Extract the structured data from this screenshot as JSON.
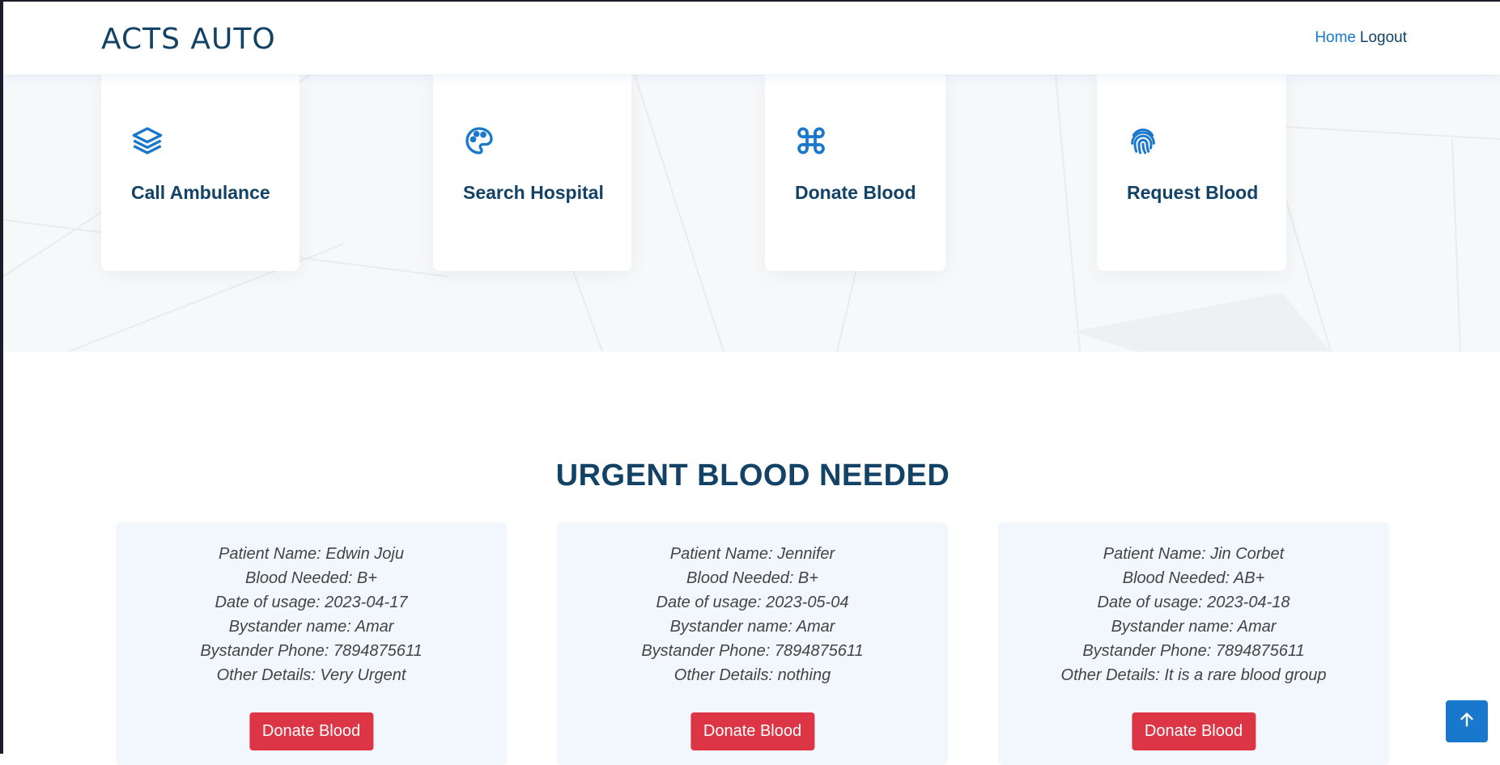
{
  "header": {
    "logo": "ACTS AUTO",
    "nav": {
      "home": "Home",
      "logout": "Logout"
    }
  },
  "features": [
    {
      "label": "Call Ambulance",
      "icon": "layers-icon"
    },
    {
      "label": "Search Hospital",
      "icon": "palette-icon"
    },
    {
      "label": "Donate Blood",
      "icon": "command-icon"
    },
    {
      "label": "Request Blood",
      "icon": "fingerprint-icon"
    }
  ],
  "section": {
    "title": "URGENT BLOOD NEEDED"
  },
  "requests": [
    {
      "patient": "Patient Name: Edwin Joju",
      "blood": "Blood Needed: B+",
      "date": "Date of usage: 2023-04-17",
      "bystander": "Bystander name: Amar",
      "phone": "Bystander Phone: 7894875611",
      "details": "Other Details: Very Urgent",
      "button": "Donate Blood"
    },
    {
      "patient": "Patient Name: Jennifer",
      "blood": "Blood Needed: B+",
      "date": "Date of usage: 2023-05-04",
      "bystander": "Bystander name: Amar",
      "phone": "Bystander Phone: 7894875611",
      "details": "Other Details: nothing",
      "button": "Donate Blood"
    },
    {
      "patient": "Patient Name: Jin Corbet",
      "blood": "Blood Needed: AB+",
      "date": "Date of usage: 2023-04-18",
      "bystander": "Bystander name: Amar",
      "phone": "Bystander Phone: 7894875611",
      "details": "Other Details: It is a rare blood group",
      "button": "Donate Blood"
    }
  ],
  "colors": {
    "primary": "#1977cc",
    "heading": "#124265",
    "danger": "#dc3545",
    "card_bg": "#f1f7fc"
  },
  "back_to_top_icon": "arrow-up-icon"
}
